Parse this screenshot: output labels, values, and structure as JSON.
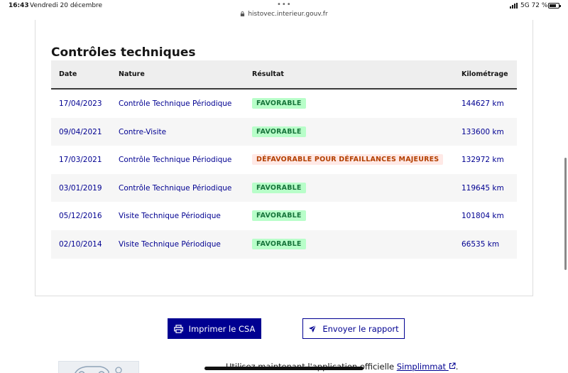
{
  "status_bar": {
    "time": "16:43",
    "date": "Vendredi 20 décembre",
    "dots": "•••",
    "url": "histovec.interieur.gouv.fr",
    "network": "5G 72 %",
    "battery_level": 0.72
  },
  "section": {
    "title": "Contrôles techniques"
  },
  "table": {
    "headers": {
      "date": "Date",
      "nature": "Nature",
      "result": "Résultat",
      "km": "Kilométrage"
    },
    "rows": [
      {
        "date": "17/04/2023",
        "nature": "Contrôle Technique Périodique",
        "result": "FAVORABLE",
        "status": "ok",
        "km": "144627 km"
      },
      {
        "date": "09/04/2021",
        "nature": "Contre-Visite",
        "result": "FAVORABLE",
        "status": "ok",
        "km": "133600 km"
      },
      {
        "date": "17/03/2021",
        "nature": "Contrôle Technique Périodique",
        "result": "DÉFAVORABLE POUR DÉFAILLANCES MAJEURES",
        "status": "ko",
        "km": "132972 km"
      },
      {
        "date": "03/01/2019",
        "nature": "Contrôle Technique Périodique",
        "result": "FAVORABLE",
        "status": "ok",
        "km": "119645 km"
      },
      {
        "date": "05/12/2016",
        "nature": "Visite Technique Périodique",
        "result": "FAVORABLE",
        "status": "ok",
        "km": "101804 km"
      },
      {
        "date": "02/10/2014",
        "nature": "Visite Technique Périodique",
        "result": "FAVORABLE",
        "status": "ok",
        "km": "66535 km"
      }
    ]
  },
  "actions": {
    "print_label": "Imprimer le CSA",
    "print_icon": "printer-icon",
    "send_label": "Envoyer le rapport",
    "send_icon": "send-icon"
  },
  "bottom": {
    "text": "Utilisez maintenant l'application officielle ",
    "link": "Simplimmat",
    "suffix": "."
  },
  "colors": {
    "primary": "#000091",
    "success_bg": "#b8fec9",
    "success_text": "#18753c",
    "error_bg": "#ffe9e6",
    "error_text": "#b34000"
  }
}
